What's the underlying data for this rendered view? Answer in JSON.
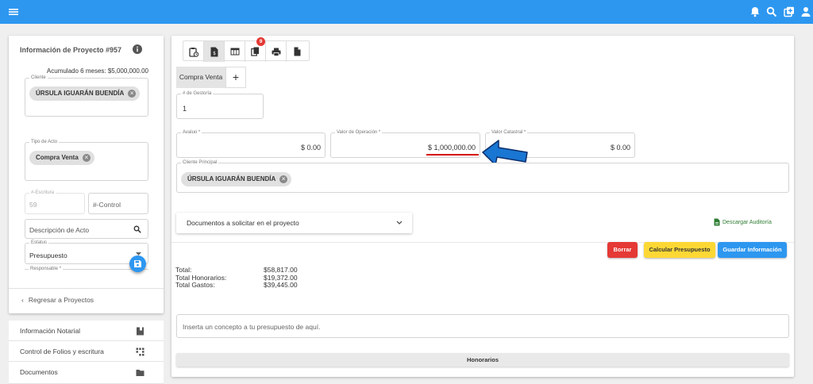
{
  "topbar": {
    "icons": [
      "menu-icon",
      "bell-icon",
      "search-icon",
      "add-box-icon",
      "account-icon"
    ]
  },
  "sidebar": {
    "title": "Información de Proyecto #957",
    "accumulated": "Acumulado 6 meses: $5,000,000.00",
    "cliente_label": "Cliente",
    "cliente_chip": "ÚRSULA IGUARÁN BUENDÍA",
    "tipo_label": "Tipo de Acto",
    "tipo_chip": "Compra Venta",
    "escritura_label": "#-Escritura",
    "escritura_value": "59",
    "control_placeholder": "#-Control",
    "descripcion_placeholder": "Descripción de Acto",
    "estatus_label": "Estatus",
    "estatus_value": "Presupuesto",
    "responsable_label": "Responsable *",
    "back_label": "Regresar a Proyectos"
  },
  "nav": {
    "items": [
      {
        "label": "Información Notarial",
        "icon": "book-icon"
      },
      {
        "label": "Control de Folios y escritura",
        "icon": "qr-grid-icon"
      },
      {
        "label": "Documentos",
        "icon": "folder-icon"
      }
    ]
  },
  "main": {
    "toolbar": {
      "icons": [
        "clipboard-clock-icon",
        "invoice-icon",
        "table-icon",
        "copy-icon",
        "print-icon",
        "file-icon"
      ],
      "badge": "9"
    },
    "tab_label": "Compra Venta",
    "gestoria_label": "# de Gestoría",
    "gestoria_value": "1",
    "avaluo_label": "Avaluo *",
    "avaluo_value": "$ 0.00",
    "operacion_label": "Valor de Operación *",
    "operacion_value": "$ 1,000,000.00",
    "catastral_label": "Valor Catastral *",
    "catastral_value": "$ 0.00",
    "cliente_principal_label": "Cliente Principal",
    "cliente_principal_chip": "ÚRSULA IGUARÁN BUENDÍA",
    "documentos_label": "Documentos a solicitar en el proyecto",
    "descargar_label": "Descargar Auditoría",
    "buttons": {
      "borrar": "Borrar",
      "calcular": "Calcular Presupuesto",
      "guardar": "Guardar Información"
    },
    "totals": [
      {
        "label": "Total:",
        "value": "$58,817.00"
      },
      {
        "label": "Total Honorarios:",
        "value": "$19,372.00"
      },
      {
        "label": "Total Gastos:",
        "value": "$39,445.00"
      }
    ],
    "concepto_placeholder": "Inserta un concepto a tu presupuesto de aquí.",
    "honorarios_label": "Honorarios"
  },
  "colors": {
    "accent": "#2d97f0",
    "borrar": "#e53935",
    "calcular": "#fdd835",
    "guardar": "#2d97f0",
    "underline": "#d50000",
    "arrow": "#1976d2"
  }
}
